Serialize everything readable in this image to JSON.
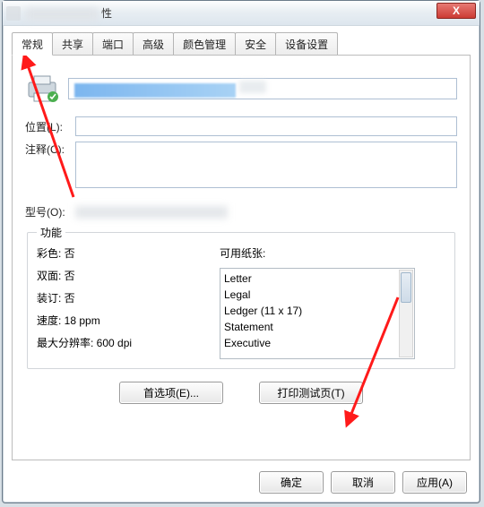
{
  "title": {
    "suffix": "性",
    "close": "X"
  },
  "tabs": [
    "常规",
    "共享",
    "端口",
    "高级",
    "颜色管理",
    "安全",
    "设备设置"
  ],
  "active_tab": 0,
  "labels": {
    "location": "位置(L):",
    "comment": "注释(C):",
    "model": "型号(O):"
  },
  "groupbox": {
    "legend": "功能",
    "paper_label": "可用纸张:",
    "items": {
      "color": "彩色: 否",
      "duplex": "双面: 否",
      "staple": "装订: 否",
      "speed": "速度: 18 ppm",
      "maxres": "最大分辨率: 600 dpi"
    },
    "paper_options": [
      "Letter",
      "Legal",
      "Ledger (11 x 17)",
      "Statement",
      "Executive"
    ]
  },
  "buttons": {
    "preferences": "首选项(E)...",
    "test_page": "打印测试页(T)"
  },
  "dialog_buttons": {
    "ok": "确定",
    "cancel": "取消",
    "apply": "应用(A)"
  }
}
